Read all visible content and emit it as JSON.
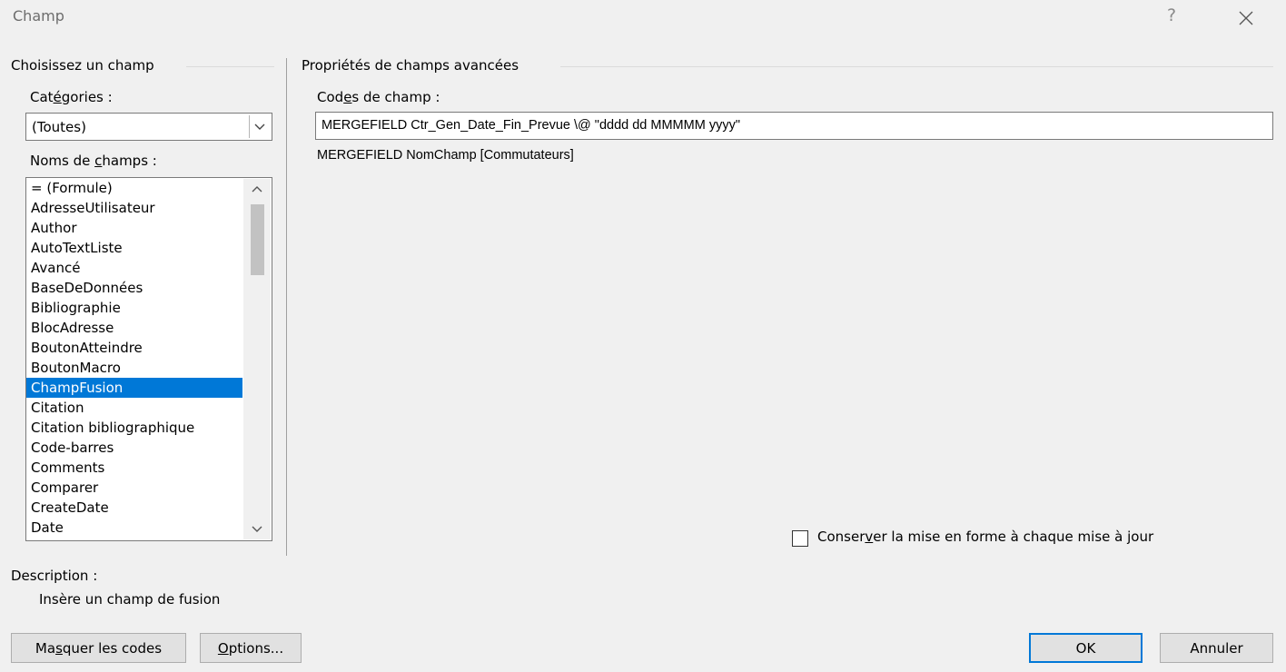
{
  "window": {
    "title": "Champ",
    "help_label": "?"
  },
  "left_panel": {
    "group_title": "Choisissez un champ",
    "categories_label": {
      "pre": "Cat",
      "key": "é",
      "post": "gories :"
    },
    "categories_value": "(Toutes)",
    "field_names_label": {
      "pre": "Noms de ",
      "key": "c",
      "post": "hamps :"
    },
    "field_names": [
      "= (Formule)",
      "AdresseUtilisateur",
      "Author",
      "AutoTextListe",
      "Avancé",
      "BaseDeDonnées",
      "Bibliographie",
      "BlocAdresse",
      "BoutonAtteindre",
      "BoutonMacro",
      "ChampFusion",
      "Citation",
      "Citation bibliographique",
      "Code-barres",
      "Comments",
      "Comparer",
      "CreateDate",
      "Date"
    ],
    "selected_field": "ChampFusion",
    "description_label": "Description :",
    "description_text": "Insère un champ de fusion"
  },
  "right_panel": {
    "group_title": "Propriétés de champs avancées",
    "field_codes_label": {
      "pre": "Cod",
      "key": "e",
      "post": "s de champ :"
    },
    "field_codes_value": "MERGEFIELD  Ctr_Gen_Date_Fin_Prevue \\@ \"dddd dd MMMMM yyyy\"",
    "syntax_hint": "MERGEFIELD NomChamp [Commutateurs]",
    "preserve_format_label": {
      "pre": "Conser",
      "key": "v",
      "post": "er la mise en forme à chaque mise à jour"
    },
    "preserve_format_checked": false
  },
  "buttons": {
    "hide_codes": {
      "pre": "Ma",
      "key": "s",
      "post": "quer les codes"
    },
    "options": {
      "pre": "",
      "key": "O",
      "post": "ptions..."
    },
    "ok": "OK",
    "cancel": "Annuler"
  },
  "colors": {
    "selection": "#0078d7",
    "dialog_bg": "#f0f0f0"
  }
}
